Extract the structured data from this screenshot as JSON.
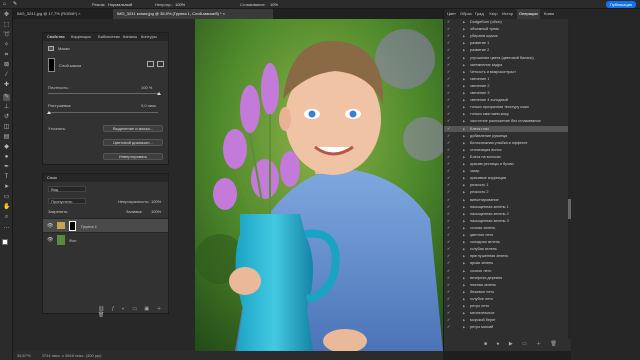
{
  "options_bar": {
    "mode_label": "Режим:",
    "mode_value": "Нормальный",
    "opacity_label": "Непрозр.:",
    "opacity_value": "100%",
    "smoothing_label": "Сглаживание:",
    "smoothing_value": "10%",
    "publish_label": "Публикация"
  },
  "tabs": [
    {
      "label": "IMG_3241.jpg @ 17,7% (RGB/8*)  ×",
      "active": false
    },
    {
      "label": "IMG_3241 копия.jpg @ 36,9% (Группа 1, Слой-маска/8) *  ×",
      "active": true
    }
  ],
  "properties": {
    "tabs": [
      "Свойства",
      "Коррекция",
      "Библиотеки",
      "Каналы",
      "Контуры"
    ],
    "masks_label": "Маски",
    "layer_mask_label": "Слой-маска",
    "density_label": "Плотность:",
    "density_value": "100 %",
    "feather_label": "Растушевка:",
    "feather_value": "0,0 пикс.",
    "refine_label": "Уточнить:",
    "select_mask_btn": "Выделение и маска...",
    "color_range_btn": "Цветовой диапазон...",
    "invert_btn": "Инвертировать"
  },
  "layers": {
    "tab_label": "Слои",
    "filter_label": "Вид",
    "blend_mode": "Пропустить",
    "opacity_label": "Непрозрачность:",
    "opacity_value": "100%",
    "lock_label": "Закрепить:",
    "fill_label": "Заливка:",
    "fill_value": "100%",
    "rows": [
      {
        "name": "Группа 1",
        "selected": true
      },
      {
        "name": "Фон",
        "selected": false
      }
    ]
  },
  "actions": {
    "tabs": [
      "Цвет",
      "Образ",
      "Град",
      "Узор",
      "Истор",
      "Операции",
      "Комм"
    ],
    "items": [
      "DodgeBurn (обыч)",
      "объемный тревк",
      "убираем шумок",
      "развитие 1",
      "развитие 2",
      "улучшение цвета (цветовой баланс)",
      "затемнение кадра",
      "Четкость и микроконтраст",
      "свечение 1",
      "свечение 2",
      "свечение 3",
      "свечение 4 холодный",
      "только прозрачная текстуру кожи",
      "только смягчаем кожу",
      "частотное разложение без сглаживания",
      "Блеск глаз",
      "добавление румянца",
      "Белоснежная улыбка в эффекте",
      "стилизация волос",
      "Блеск на волосах",
      "красим ресницы и брови",
      "загар",
      "красивые коррекции",
      "резкость 1",
      "резкость 2",
      "виньетирование",
      "насыщенная зелень 1",
      "насыщенная зелень 2",
      "насыщенная зелень 3",
      "сочная зелень",
      "цветное лето",
      "холодная зелень",
      "голубая зелень",
      "приглушенная зелень",
      "яркая зелень",
      "сочное лето",
      "вечерняя деревня",
      "нежная зелень",
      "бежевое лето",
      "голубое лето",
      "ретро лето",
      "мечтательное",
      "морской берег",
      "ретро мягкий"
    ],
    "highlight_index": 15
  },
  "status": {
    "zoom": "36,87%",
    "doc_info": "3744 пикс. x 5616 пикс. (300 ppi)"
  },
  "colors": {
    "accent": "#1473e6",
    "bg": "#1e1e1e",
    "panel": "#323232"
  }
}
